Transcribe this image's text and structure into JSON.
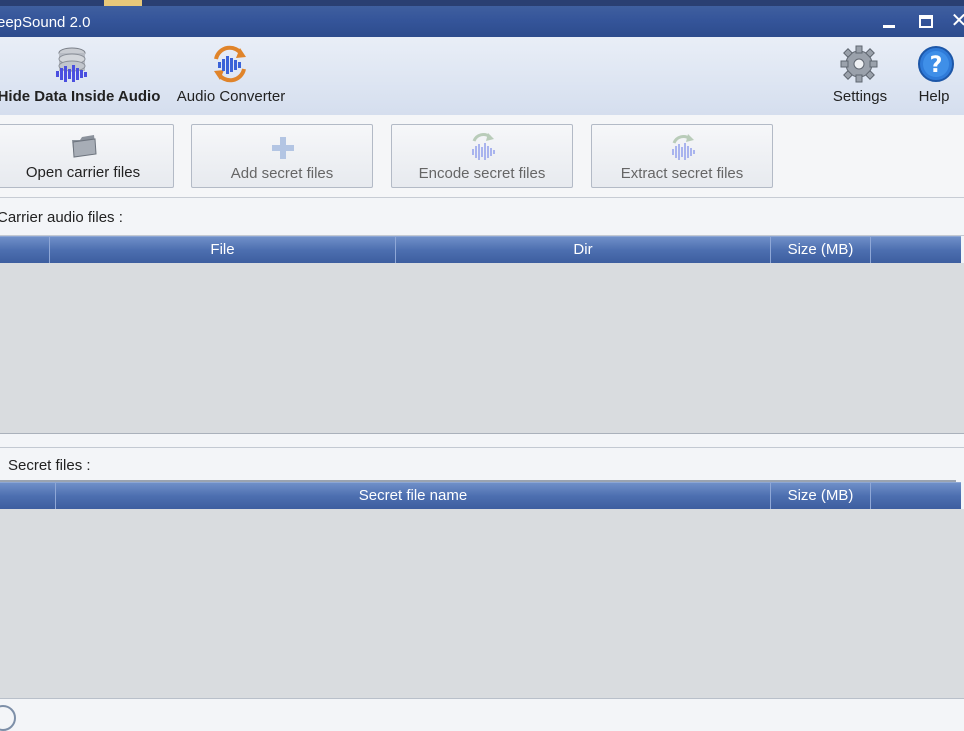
{
  "window": {
    "title": "eepSound 2.0",
    "controls": {
      "minimize": "minimize",
      "maximize": "maximize",
      "close": "✕"
    }
  },
  "ribbon": {
    "items": [
      {
        "label": "Hide Data Inside Audio",
        "icon": "database-audio-icon"
      },
      {
        "label": "Audio Converter",
        "icon": "audio-convert-icon"
      },
      {
        "label": "Settings",
        "icon": "gear-icon"
      },
      {
        "label": "Help",
        "icon": "help-icon"
      }
    ]
  },
  "toolbar": {
    "open_carrier": "Open carrier files",
    "add_secret": "Add secret files",
    "encode_secret": "Encode secret files",
    "extract_secret": "Extract secret files"
  },
  "carrier": {
    "label": "Carrier audio files :",
    "columns": [
      "",
      "File",
      "Dir",
      "Size (MB)",
      ""
    ]
  },
  "secret": {
    "label": "Secret files :",
    "columns": [
      "",
      "Secret file name",
      "Size (MB)",
      ""
    ]
  },
  "colors": {
    "titlebar": "#35559a",
    "grid_header": "#4d6fb0",
    "grid_body": "#d9dcdf",
    "ribbon": "#dde5f2"
  }
}
